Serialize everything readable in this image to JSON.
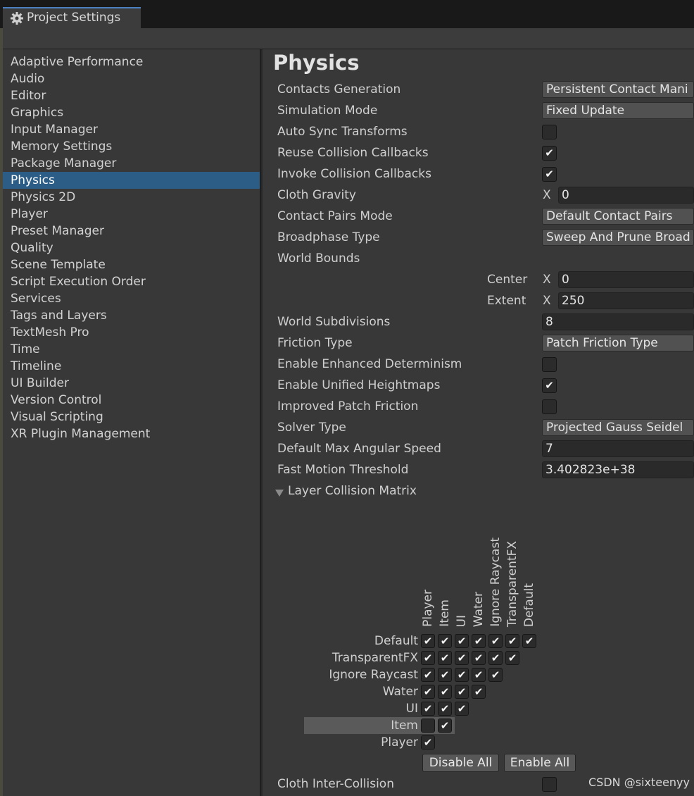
{
  "window": {
    "tab_title": "Project Settings",
    "tab_icon": "gear-icon"
  },
  "sidebar": {
    "items": [
      {
        "label": "Adaptive Performance",
        "selected": false
      },
      {
        "label": "Audio",
        "selected": false
      },
      {
        "label": "Editor",
        "selected": false
      },
      {
        "label": "Graphics",
        "selected": false
      },
      {
        "label": "Input Manager",
        "selected": false
      },
      {
        "label": "Memory Settings",
        "selected": false
      },
      {
        "label": "Package Manager",
        "selected": false
      },
      {
        "label": "Physics",
        "selected": true
      },
      {
        "label": "Physics 2D",
        "selected": false
      },
      {
        "label": "Player",
        "selected": false
      },
      {
        "label": "Preset Manager",
        "selected": false
      },
      {
        "label": "Quality",
        "selected": false
      },
      {
        "label": "Scene Template",
        "selected": false
      },
      {
        "label": "Script Execution Order",
        "selected": false
      },
      {
        "label": "Services",
        "selected": false
      },
      {
        "label": "Tags and Layers",
        "selected": false
      },
      {
        "label": "TextMesh Pro",
        "selected": false
      },
      {
        "label": "Time",
        "selected": false
      },
      {
        "label": "Timeline",
        "selected": false
      },
      {
        "label": "UI Builder",
        "selected": false
      },
      {
        "label": "Version Control",
        "selected": false
      },
      {
        "label": "Visual Scripting",
        "selected": false
      },
      {
        "label": "XR Plugin Management",
        "selected": false
      }
    ]
  },
  "physics": {
    "title": "Physics",
    "contacts_generation": {
      "label": "Contacts Generation",
      "value": "Persistent Contact Mani"
    },
    "simulation_mode": {
      "label": "Simulation Mode",
      "value": "Fixed Update"
    },
    "auto_sync_transforms": {
      "label": "Auto Sync Transforms",
      "checked": false
    },
    "reuse_collision_callbacks": {
      "label": "Reuse Collision Callbacks",
      "checked": true
    },
    "invoke_collision_callbacks": {
      "label": "Invoke Collision Callbacks",
      "checked": true
    },
    "cloth_gravity": {
      "label": "Cloth Gravity",
      "axis": "X",
      "x": "0"
    },
    "contact_pairs_mode": {
      "label": "Contact Pairs Mode",
      "value": "Default Contact Pairs"
    },
    "broadphase_type": {
      "label": "Broadphase Type",
      "value": "Sweep And Prune Broad"
    },
    "world_bounds": {
      "label": "World Bounds",
      "center_label": "Center",
      "center_axis": "X",
      "center_x": "0",
      "extent_label": "Extent",
      "extent_axis": "X",
      "extent_x": "250"
    },
    "world_subdivisions": {
      "label": "World Subdivisions",
      "value": "8"
    },
    "friction_type": {
      "label": "Friction Type",
      "value": "Patch Friction Type"
    },
    "enhanced_determinism": {
      "label": "Enable Enhanced Determinism",
      "checked": false
    },
    "unified_heightmaps": {
      "label": "Enable Unified Heightmaps",
      "checked": true
    },
    "improved_patch_friction": {
      "label": "Improved Patch Friction",
      "checked": false
    },
    "solver_type": {
      "label": "Solver Type",
      "value": "Projected Gauss Seidel"
    },
    "default_max_angular_speed": {
      "label": "Default Max Angular Speed",
      "value": "7"
    },
    "fast_motion_threshold": {
      "label": "Fast Motion Threshold",
      "value": "3.402823e+38"
    },
    "layer_collision_matrix": {
      "label": "Layer Collision Matrix",
      "expanded": true,
      "column_layers": [
        "Player",
        "Item",
        "UI",
        "Water",
        "Ignore Raycast",
        "TransparentFX",
        "Default"
      ],
      "row_layers": [
        "Default",
        "TransparentFX",
        "Ignore Raycast",
        "Water",
        "UI",
        "Item",
        "Player"
      ],
      "highlighted_row": "Item",
      "rows": [
        {
          "layer": "Default",
          "checks": [
            true,
            true,
            true,
            true,
            true,
            true,
            true
          ]
        },
        {
          "layer": "TransparentFX",
          "checks": [
            true,
            true,
            true,
            true,
            true,
            true
          ]
        },
        {
          "layer": "Ignore Raycast",
          "checks": [
            true,
            true,
            true,
            true,
            true
          ]
        },
        {
          "layer": "Water",
          "checks": [
            true,
            true,
            true,
            true
          ]
        },
        {
          "layer": "UI",
          "checks": [
            true,
            true,
            true
          ]
        },
        {
          "layer": "Item",
          "checks": [
            false,
            true
          ]
        },
        {
          "layer": "Player",
          "checks": [
            true
          ]
        }
      ],
      "disable_all_label": "Disable All",
      "enable_all_label": "Enable All"
    },
    "cloth_inter_collision": {
      "label": "Cloth Inter-Collision",
      "checked": false
    }
  },
  "watermark": "CSDN @sixteenyy",
  "colors": {
    "selection": "#2c5d87",
    "panel": "#383838",
    "field": "#2a2a2a",
    "dropdown": "#515151"
  }
}
